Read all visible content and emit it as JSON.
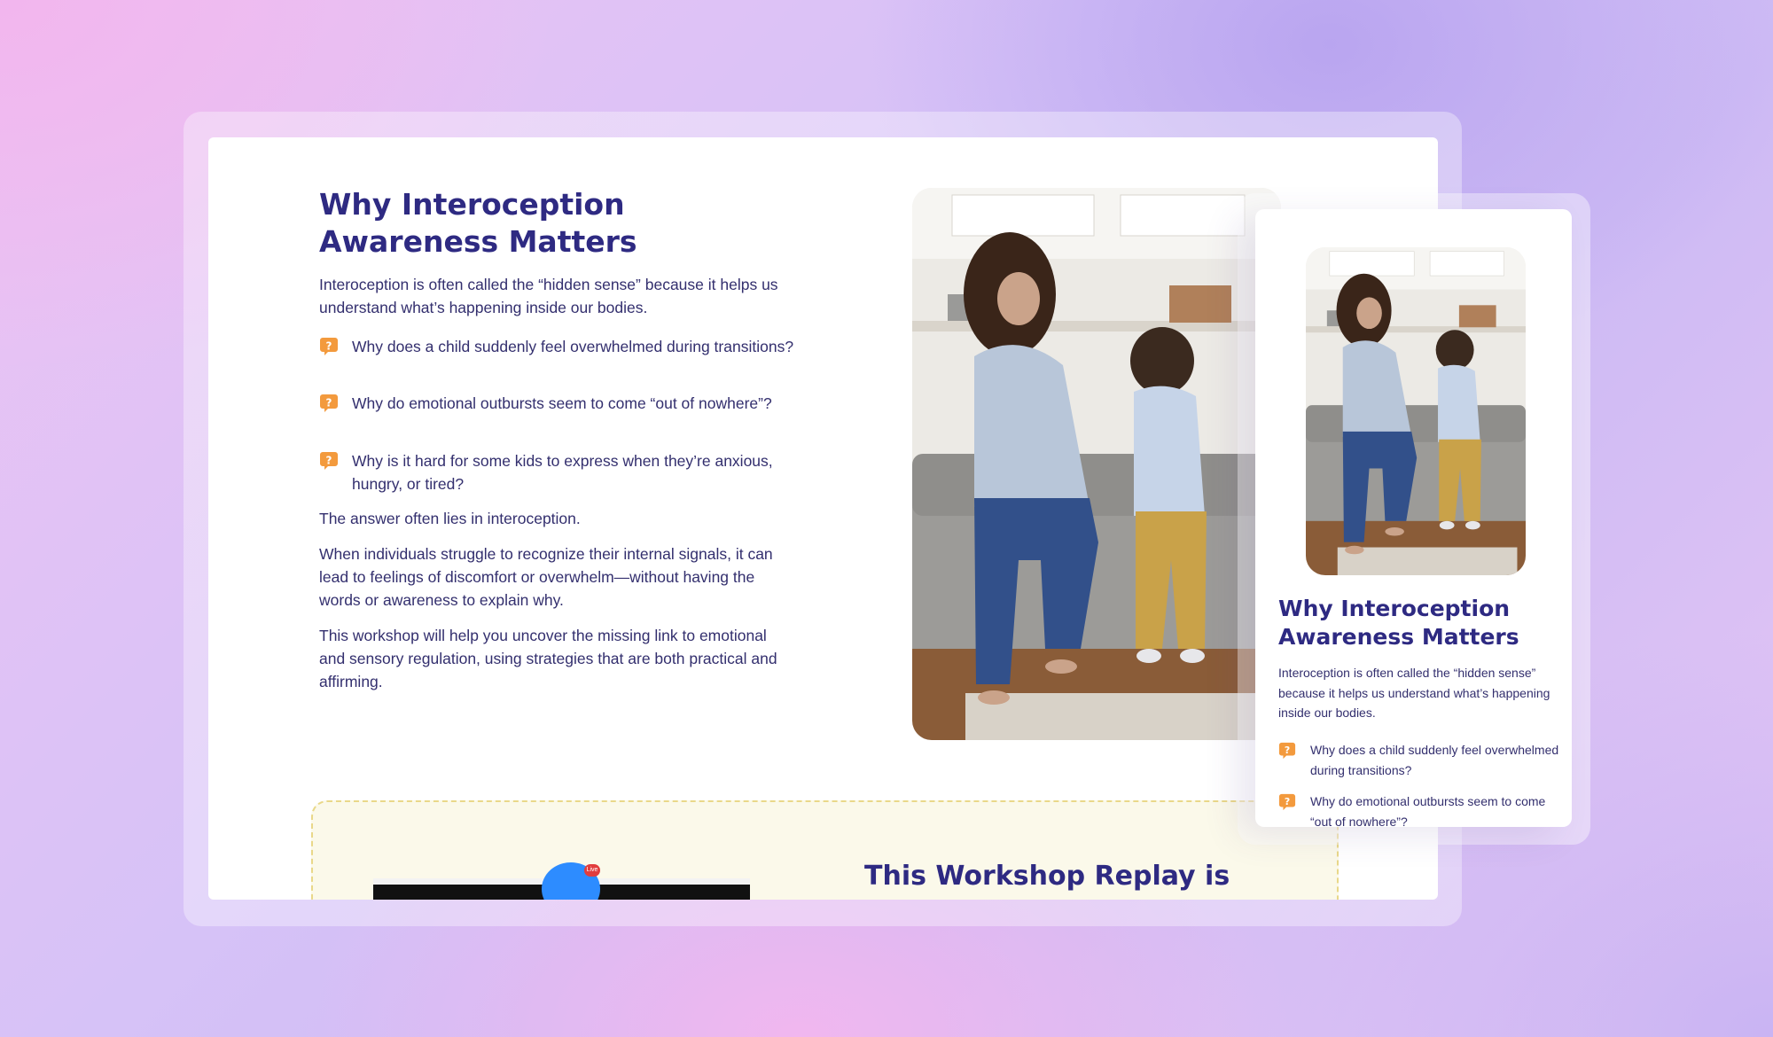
{
  "desktop": {
    "title": "Why Interoception Awareness Matters",
    "intro": "Interoception is often called the “hidden sense” because it helps us understand what’s happening inside our bodies.",
    "questions": [
      "Why does a child suddenly feel overwhelmed during transitions?",
      "Why do emotional outbursts seem to come “out of nowhere”?",
      "Why is it hard for some kids to express when they’re anxious, hungry, or tired?"
    ],
    "answer": "The answer often lies in interoception.",
    "para2": "When individuals struggle to recognize their internal signals, it can lead to feelings of discomfort or overwhelm—without having the words or awareness to explain why.",
    "para3": "This workshop will help you uncover the missing link to emotional and sensory regulation, using strategies that are both practical and affirming.",
    "cta_title": "This Workshop Replay is",
    "live_badge": "Live"
  },
  "mobile": {
    "title": "Why Interoception Awareness Matters",
    "intro": "Interoception is often called the “hidden sense” because it helps us understand what’s happening inside our bodies.",
    "questions": [
      "Why does a child suddenly feel overwhelmed during transitions?",
      "Why do emotional outbursts seem to come “out of nowhere”?"
    ]
  },
  "colors": {
    "heading": "#2e2a82",
    "body_text": "#332f6e",
    "question_icon": "#f39a3d",
    "cta_background": "#fbf9ea",
    "cta_border": "#e9d889"
  },
  "icons": {
    "question": "question-bubble-icon"
  }
}
